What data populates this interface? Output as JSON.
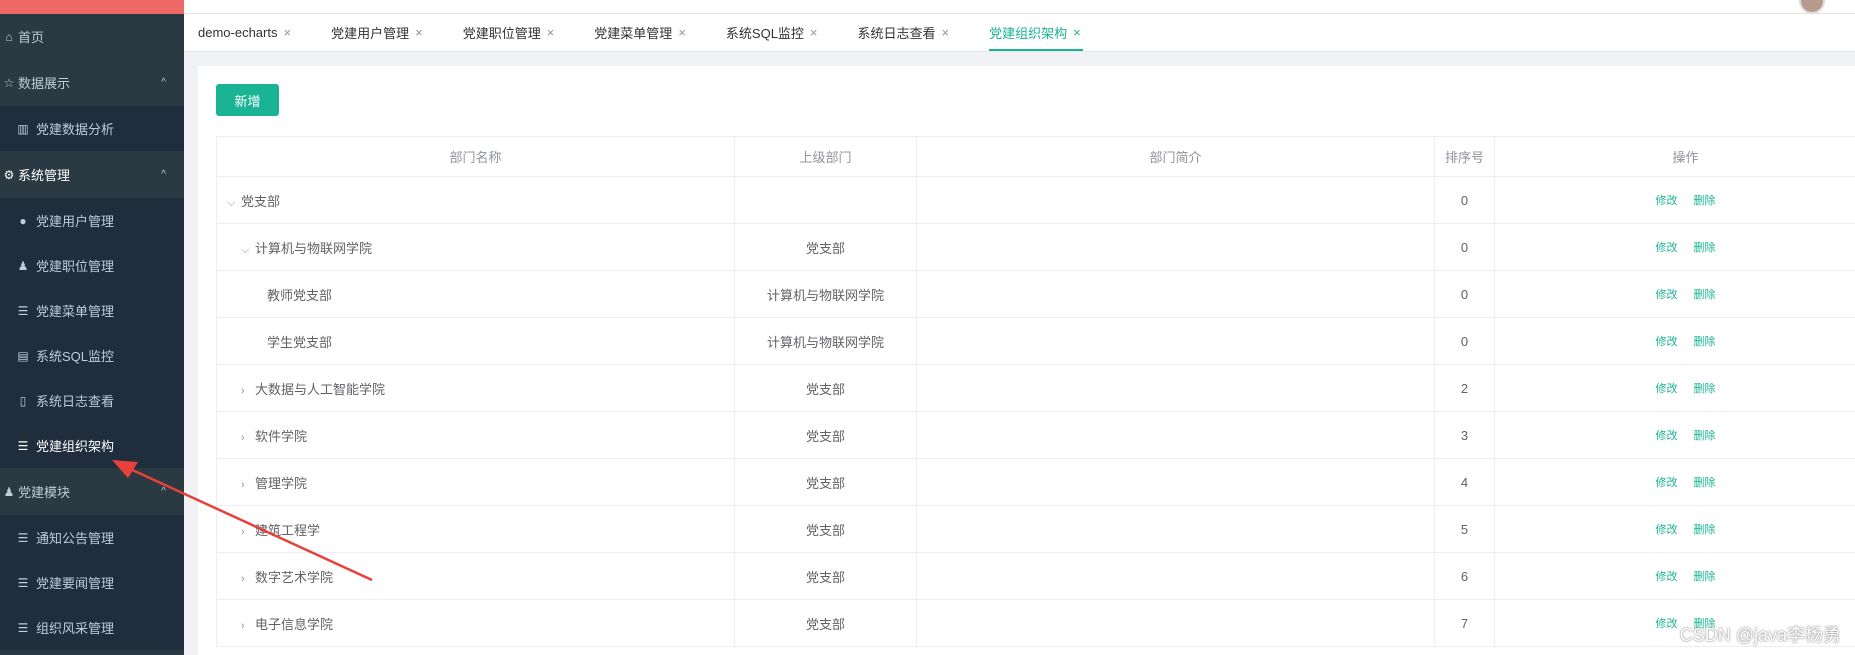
{
  "sidebar": {
    "items": [
      {
        "label": "首页",
        "icon": "home-icon"
      },
      {
        "label": "数据展示",
        "icon": "star-icon",
        "group": true,
        "arrow": "^"
      },
      {
        "label": "党建数据分析",
        "icon": "bar-chart-icon",
        "sub": true
      },
      {
        "label": "系统管理",
        "icon": "gear-icon",
        "group": true,
        "arrow": "^"
      },
      {
        "label": "党建用户管理",
        "icon": "user-icon",
        "sub": true
      },
      {
        "label": "党建职位管理",
        "icon": "user-tie-icon",
        "sub": true
      },
      {
        "label": "党建菜单管理",
        "icon": "list-icon",
        "sub": true
      },
      {
        "label": "系统SQL监控",
        "icon": "monitor-icon",
        "sub": true
      },
      {
        "label": "系统日志查看",
        "icon": "doc-icon",
        "sub": true
      },
      {
        "label": "党建组织架构",
        "icon": "list-icon",
        "sub": true,
        "current": true
      },
      {
        "label": "党建模块",
        "icon": "users-icon",
        "group": true,
        "arrow": "^"
      },
      {
        "label": "通知公告管理",
        "icon": "list-icon",
        "sub": true
      },
      {
        "label": "党建要闻管理",
        "icon": "list-icon",
        "sub": true
      },
      {
        "label": "组织风采管理",
        "icon": "list-icon",
        "sub": true
      }
    ]
  },
  "tabs": [
    {
      "label": "demo-echarts"
    },
    {
      "label": "党建用户管理"
    },
    {
      "label": "党建职位管理"
    },
    {
      "label": "党建菜单管理"
    },
    {
      "label": "系统SQL监控"
    },
    {
      "label": "系统日志查看"
    },
    {
      "label": "党建组织架构",
      "active": true
    }
  ],
  "toolbar": {
    "add_label": "新增"
  },
  "table": {
    "columns": [
      "部门名称",
      "上级部门",
      "部门简介",
      "排序号",
      "操作"
    ],
    "edit_label": "修改",
    "delete_label": "删除",
    "rows": [
      {
        "name": "党支部",
        "parent": "",
        "desc": "",
        "order": "0",
        "level": 0,
        "expander": "⌵"
      },
      {
        "name": "计算机与物联网学院",
        "parent": "党支部",
        "desc": "",
        "order": "0",
        "level": 1,
        "expander": "⌵"
      },
      {
        "name": "教师党支部",
        "parent": "计算机与物联网学院",
        "desc": "",
        "order": "0",
        "level": 2,
        "expander": ""
      },
      {
        "name": "学生党支部",
        "parent": "计算机与物联网学院",
        "desc": "",
        "order": "0",
        "level": 2,
        "expander": ""
      },
      {
        "name": "大数据与人工智能学院",
        "parent": "党支部",
        "desc": "",
        "order": "2",
        "level": 1,
        "expander": "›"
      },
      {
        "name": "软件学院",
        "parent": "党支部",
        "desc": "",
        "order": "3",
        "level": 1,
        "expander": "›"
      },
      {
        "name": "管理学院",
        "parent": "党支部",
        "desc": "",
        "order": "4",
        "level": 1,
        "expander": "›"
      },
      {
        "name": "建筑工程学",
        "parent": "党支部",
        "desc": "",
        "order": "5",
        "level": 1,
        "expander": "›"
      },
      {
        "name": "数字艺术学院",
        "parent": "党支部",
        "desc": "",
        "order": "6",
        "level": 1,
        "expander": "›"
      },
      {
        "name": "电子信息学院",
        "parent": "党支部",
        "desc": "",
        "order": "7",
        "level": 1,
        "expander": "›"
      }
    ]
  },
  "watermark": "CSDN @java李杨勇",
  "colors": {
    "accent": "#1ab394",
    "sidebar_bg": "#2b3a42",
    "annotation": "#e8403a"
  }
}
